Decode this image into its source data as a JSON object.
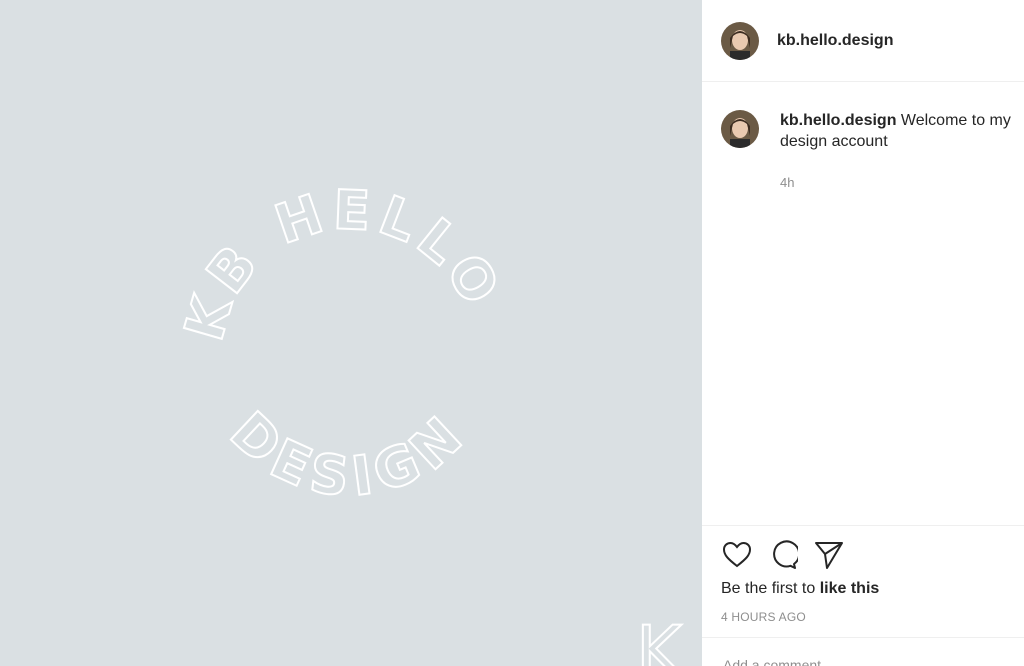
{
  "post_image": {
    "logo_arc_top": "KB HELLO",
    "logo_arc_bottom": "DESIGN",
    "corner_mark": "K"
  },
  "header": {
    "username": "kb.hello.design"
  },
  "caption": {
    "username": "kb.hello.design",
    "text": " Welcome to my design account",
    "time": "4h"
  },
  "actions": {
    "like_icon": "heart-icon",
    "comment_icon": "comment-icon",
    "share_icon": "paper-plane-icon"
  },
  "likes": {
    "prefix": "Be the first to ",
    "link": "like this"
  },
  "posted_time": "4 HOURS AGO",
  "add_comment": {
    "placeholder": "Add a comment…"
  },
  "colors": {
    "image_bg": "#dae0e3",
    "text": "#262626",
    "muted": "#8e8e8e"
  }
}
